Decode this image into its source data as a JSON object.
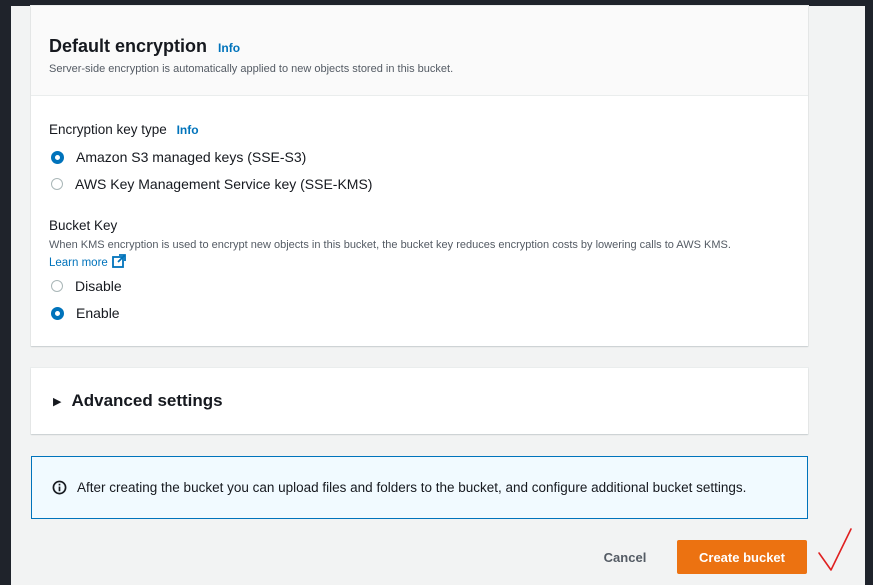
{
  "encryption": {
    "title": "Default encryption",
    "info_label": "Info",
    "description": "Server-side encryption is automatically applied to new objects stored in this bucket.",
    "key_type_label": "Encryption key type",
    "key_type_info": "Info",
    "options": [
      {
        "label": "Amazon S3 managed keys (SSE-S3)",
        "selected": true
      },
      {
        "label": "AWS Key Management Service key (SSE-KMS)",
        "selected": false
      }
    ],
    "bucket_key": {
      "label": "Bucket Key",
      "description": "When KMS encryption is used to encrypt new objects in this bucket, the bucket key reduces encryption costs by lowering calls to AWS KMS.",
      "learn_more": "Learn more",
      "options": [
        {
          "label": "Disable",
          "selected": false
        },
        {
          "label": "Enable",
          "selected": true
        }
      ]
    }
  },
  "advanced": {
    "label": "Advanced settings",
    "expanded": false
  },
  "alert": {
    "text": "After creating the bucket you can upload files and folders to the bucket, and configure additional bucket settings."
  },
  "footer": {
    "cancel_label": "Cancel",
    "create_label": "Create bucket"
  },
  "colors": {
    "primary": "#ec7211",
    "link": "#0073bb",
    "annotation": "#e02020"
  },
  "icons": [
    "external-link-icon",
    "info-circle-icon",
    "caret-right-icon",
    "checkmark-annotation-icon"
  ]
}
